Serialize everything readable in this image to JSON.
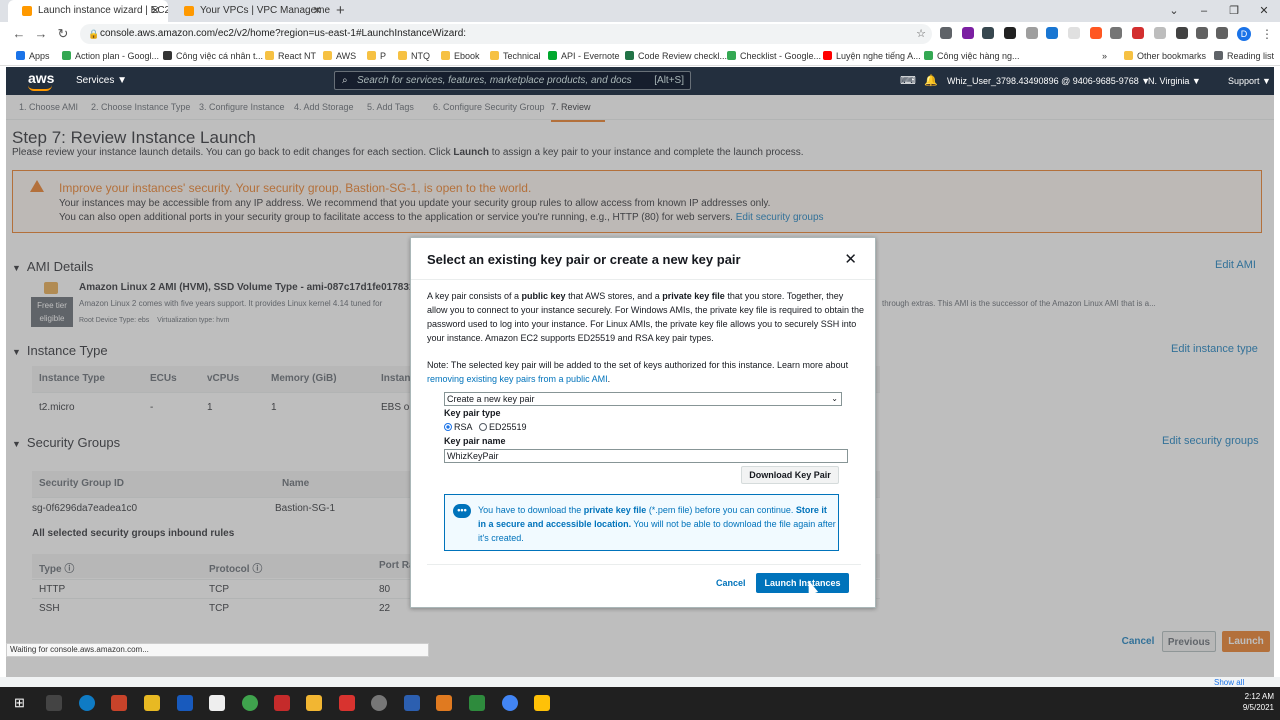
{
  "browser": {
    "tabs": [
      {
        "title": "Launch instance wizard | EC2 Ma",
        "active": true
      },
      {
        "title": "Your VPCs | VPC Management C",
        "active": false
      }
    ],
    "url": "console.aws.amazon.com/ec2/v2/home?region=us-east-1#LaunchInstanceWizard:",
    "profile_initial": "D",
    "bookmarks": [
      "Apps",
      "Action plan - Googl...",
      "Công việc cá nhân t...",
      "React NT",
      "AWS",
      "P",
      "NTQ",
      "Ebook",
      "Technical",
      "API - Evernote",
      "Code Review checkl...",
      "Checklist - Google...",
      "Luyện nghe tiếng A...",
      "Công việc hàng ng..."
    ],
    "other_bookmarks": "Other bookmarks",
    "reading_list": "Reading list",
    "status": "Waiting for console.aws.amazon.com..."
  },
  "aws_nav": {
    "logo": "aws",
    "services": "Services",
    "search_placeholder": "Search for services, features, marketplace products, and docs",
    "search_shortcut": "[Alt+S]",
    "account": "Whiz_User_3798.43490896 @ 9406-9685-9768",
    "region": "N. Virginia",
    "support": "Support"
  },
  "steps": [
    "1. Choose AMI",
    "2. Choose Instance Type",
    "3. Configure Instance",
    "4. Add Storage",
    "5. Add Tags",
    "6. Configure Security Group",
    "7. Review"
  ],
  "page": {
    "title": "Step 7: Review Instance Launch",
    "subtitle_pre": "Please review your instance launch details. You can go back to edit changes for each section. Click ",
    "subtitle_bold": "Launch",
    "subtitle_post": " to assign a key pair to your instance and complete the launch process.",
    "warning_title": "Improve your instances' security. Your security group, Bastion-SG-1, is open to the world.",
    "warning_line1": "Your instances may be accessible from any IP address. We recommend that you update your security group rules to allow access from known IP addresses only.",
    "warning_line2": "You can also open additional ports in your security group to facilitate access to the application or service you're running, e.g., HTTP (80) for web servers.",
    "warning_link": "Edit security groups"
  },
  "ami": {
    "heading": "AMI Details",
    "edit": "Edit AMI",
    "name": "Amazon Linux 2 AMI (HVM), SSD Volume Type - ami-087c17d1fe017831",
    "desc": "Amazon Linux 2 comes with five years support. It provides Linux kernel 4.14 tuned for",
    "desc_right": "through extras. This AMI is the successor of the Amazon Linux AMI that is a...",
    "badge_line1": "Free tier",
    "badge_line2": "eligible",
    "meta": "Root Device Type: ebs    Virtualization type: hvm"
  },
  "instance_type": {
    "heading": "Instance Type",
    "edit": "Edit instance type",
    "headers": [
      "Instance Type",
      "ECUs",
      "vCPUs",
      "Memory (GiB)",
      "Instance"
    ],
    "row": [
      "t2.micro",
      "-",
      "1",
      "1",
      "EBS o"
    ]
  },
  "security_groups": {
    "heading": "Security Groups",
    "edit": "Edit security groups",
    "headers": [
      "Security Group ID",
      "Name"
    ],
    "row": [
      "sg-0f6296da7eadea1c0",
      "Bastion-SG-1"
    ],
    "inbound_title": "All selected security groups inbound rules",
    "rule_headers": [
      "Type",
      "Protocol",
      "Port Ra"
    ],
    "rules": [
      [
        "HTTP",
        "TCP",
        "80"
      ],
      [
        "SSH",
        "TCP",
        "22"
      ]
    ]
  },
  "footer_buttons": {
    "cancel": "Cancel",
    "previous": "Previous",
    "launch": "Launch"
  },
  "modal": {
    "title": "Select an existing key pair or create a new key pair",
    "p1_a": "A key pair consists of a ",
    "p1_b": "public key",
    "p1_c": " that AWS stores, and a ",
    "p1_d": "private key file",
    "p1_e": " that you store. Together, they allow you to connect to your instance securely. For Windows AMIs, the private key file is required to obtain the password used to log into your instance. For Linux AMIs, the private key file allows you to securely SSH into your instance. Amazon EC2 supports ED25519 and RSA key pair types.",
    "p2_a": "Note: The selected key pair will be added to the set of keys authorized for this instance. Learn more about ",
    "p2_link": "removing existing key pairs from a public AMI",
    "p2_b": ".",
    "select_value": "Create a new key pair",
    "type_label": "Key pair type",
    "type_options": [
      "RSA",
      "ED25519"
    ],
    "type_selected": "RSA",
    "name_label": "Key pair name",
    "name_value": "WhizKeyPair",
    "download": "Download Key Pair",
    "info_a": "You have to download the ",
    "info_b": "private key file",
    "info_c": " (*.pem file) before you can continue. ",
    "info_d": "Store it in a secure and accessible location.",
    "info_e": " You will not be able to download the file again after it's created.",
    "cancel": "Cancel",
    "launch": "Launch Instances"
  },
  "taskbar": {
    "time": "2:12 AM",
    "date": "9/5/2021",
    "show_all": "Show all"
  }
}
